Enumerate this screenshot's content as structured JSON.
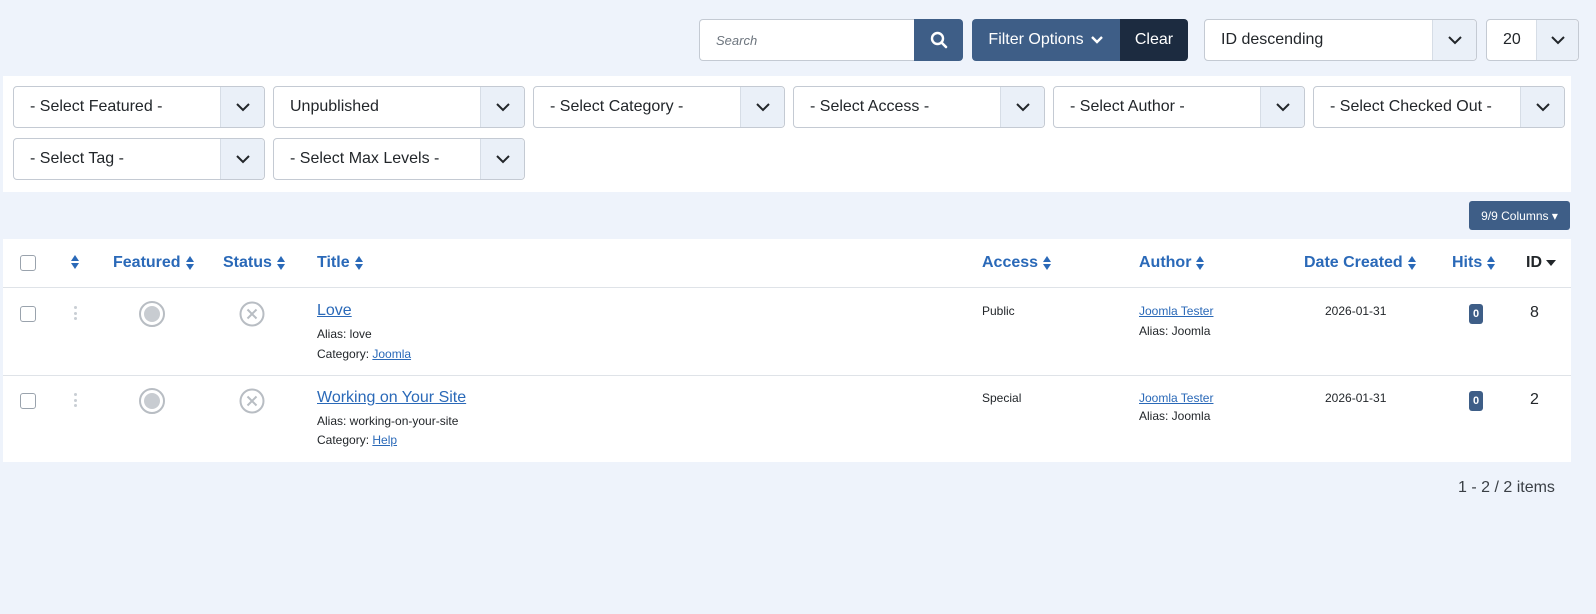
{
  "toolbar": {
    "search_placeholder": "Search",
    "filter_options_label": "Filter Options",
    "clear_label": "Clear",
    "ordering_selected": "ID descending",
    "limit_selected": "20"
  },
  "filters": {
    "featured": "- Select Featured -",
    "published": "Unpublished",
    "category": "- Select Category -",
    "access": "- Select Access -",
    "author": "- Select Author -",
    "checked_out": "- Select Checked Out -",
    "tag": "- Select Tag -",
    "max_levels": "- Select Max Levels -"
  },
  "columns_button": "9/9 Columns",
  "table": {
    "headers": {
      "featured": "Featured",
      "status": "Status",
      "title": "Title",
      "access": "Access",
      "author": "Author",
      "date_created": "Date Created",
      "hits": "Hits",
      "id": "ID"
    },
    "rows": [
      {
        "title": "Love",
        "alias_label": "Alias: love",
        "category_prefix": "Category: ",
        "category": "Joomla",
        "access": "Public",
        "author": "Joomla Tester",
        "author_alias": "Alias: Joomla",
        "date_created": "2026-01-31",
        "hits": "0",
        "id": "8"
      },
      {
        "title": "Working on Your Site",
        "alias_label": "Alias: working-on-your-site",
        "category_prefix": "Category: ",
        "category": "Help",
        "access": "Special",
        "author": "Joomla Tester",
        "author_alias": "Alias: Joomla",
        "date_created": "2026-01-31",
        "hits": "0",
        "id": "2"
      }
    ]
  },
  "pagination_info": "1 - 2 / 2 items",
  "colors": {
    "primary": "#3e5e87",
    "dark": "#1c2b40",
    "link": "#2a69b8",
    "background": "#eef3fb"
  }
}
